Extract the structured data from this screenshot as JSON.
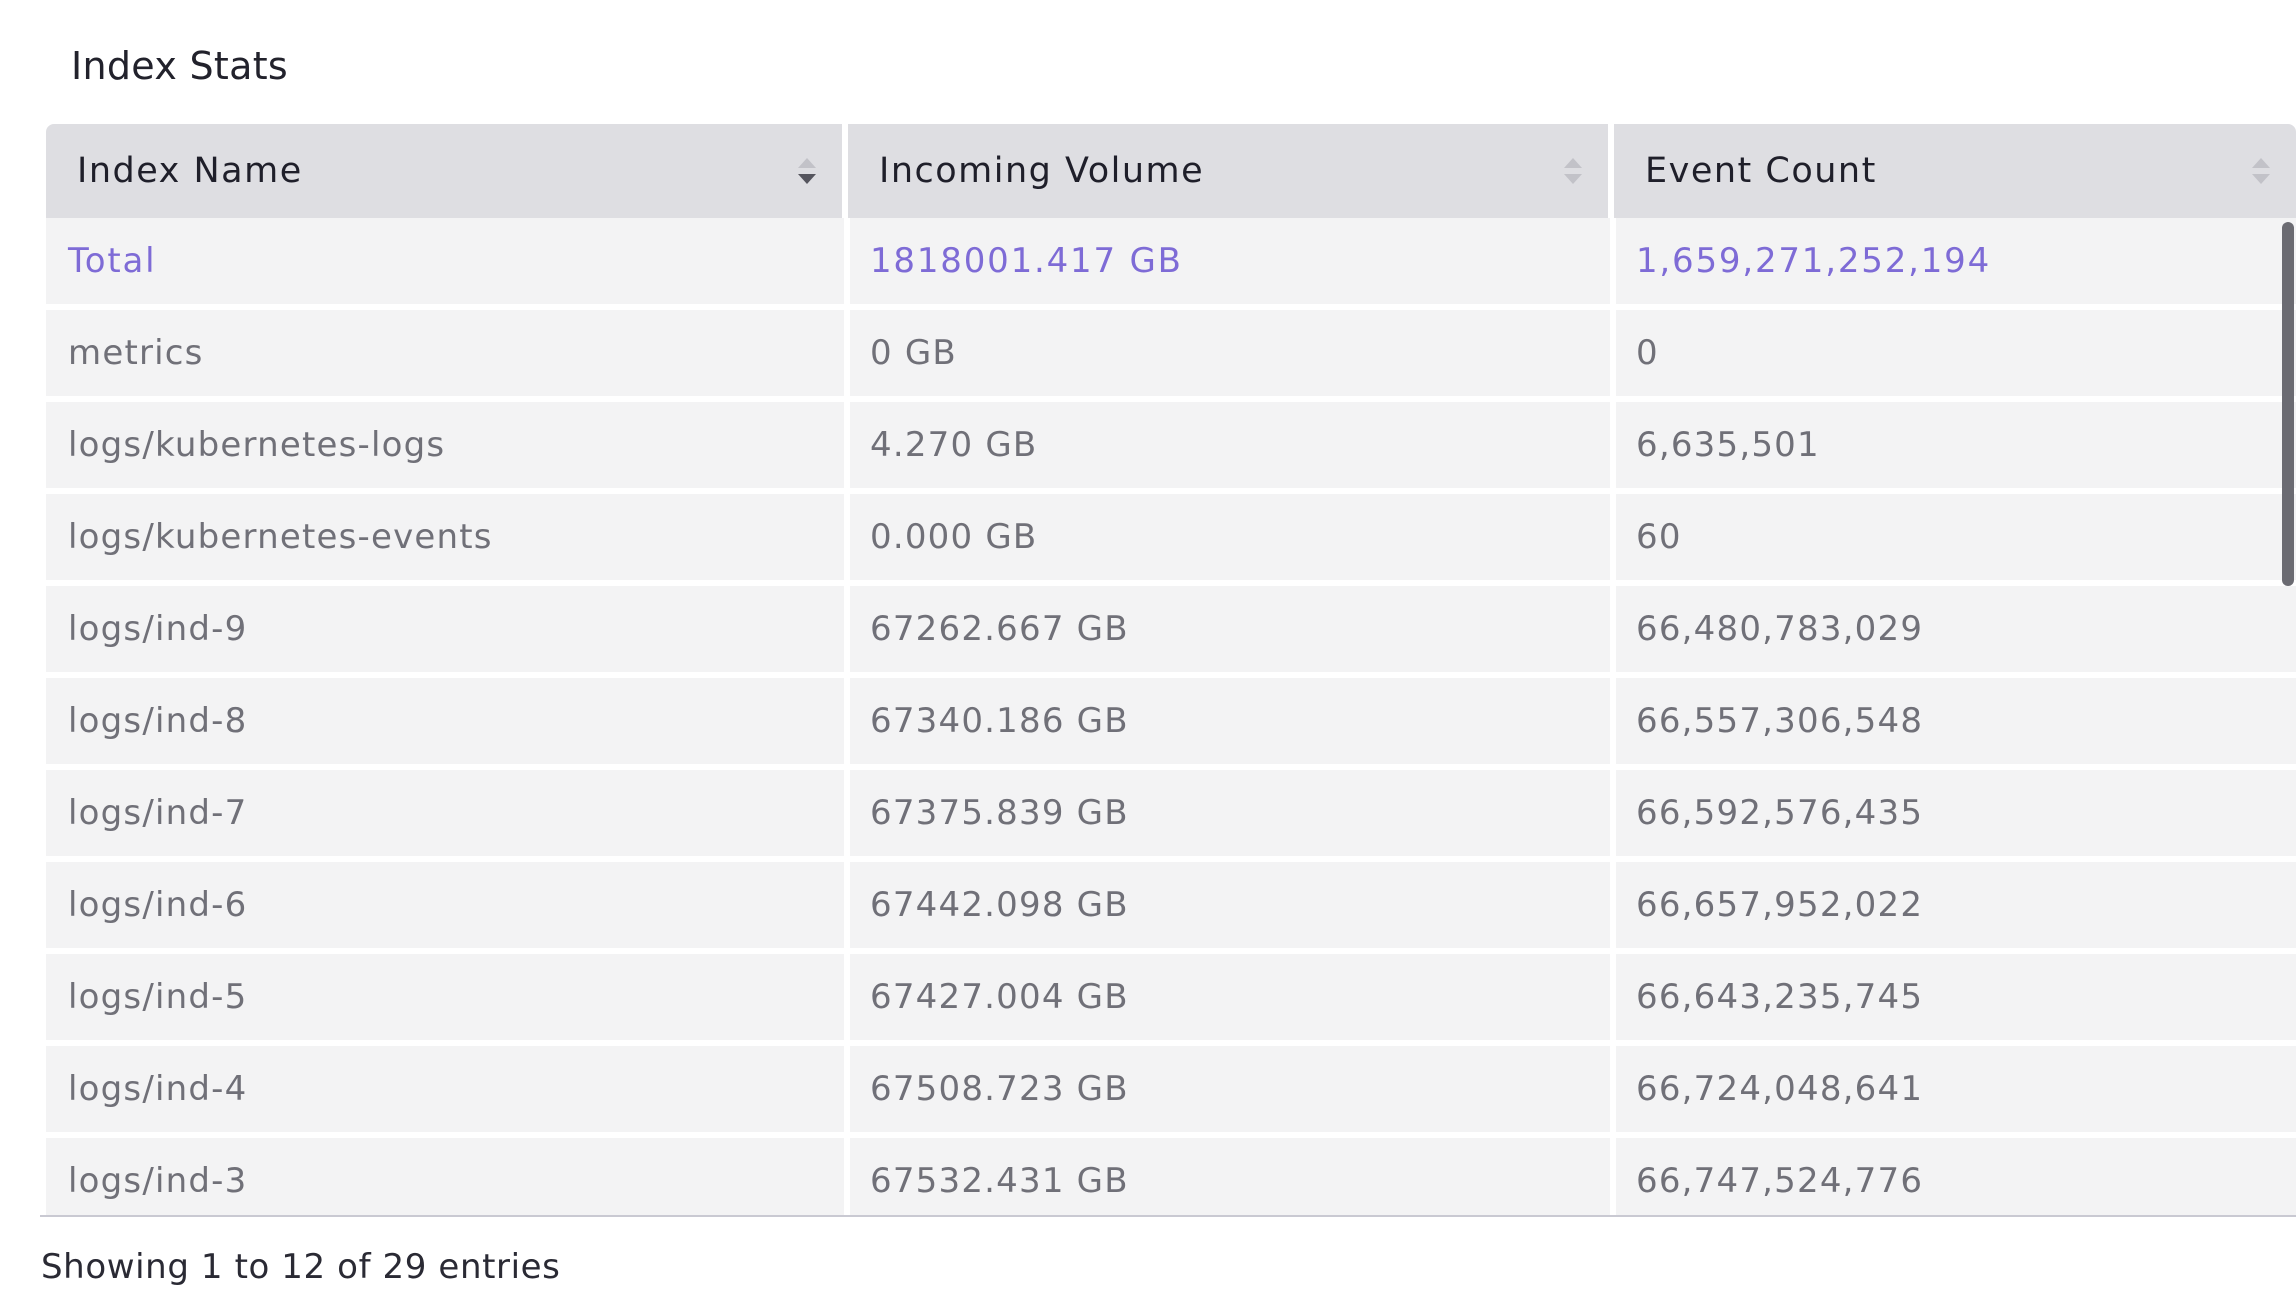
{
  "page": {
    "title": "Index Stats"
  },
  "table": {
    "columns": [
      "Index Name",
      "Incoming Volume",
      "Event Count"
    ],
    "sorted_column": "Index Name",
    "sort_direction": "descending",
    "total": [
      "Total",
      "1818001.417 GB",
      "1,659,271,252,194"
    ],
    "rows": [
      [
        "metrics",
        "0 GB",
        "0"
      ],
      [
        "logs/kubernetes-logs",
        "4.270 GB",
        "6,635,501"
      ],
      [
        "logs/kubernetes-events",
        "0.000 GB",
        "60"
      ],
      [
        "logs/ind-9",
        "67262.667 GB",
        "66,480,783,029"
      ],
      [
        "logs/ind-8",
        "67340.186 GB",
        "66,557,306,548"
      ],
      [
        "logs/ind-7",
        "67375.839 GB",
        "66,592,576,435"
      ],
      [
        "logs/ind-6",
        "67442.098 GB",
        "66,657,952,022"
      ],
      [
        "logs/ind-5",
        "67427.004 GB",
        "66,643,235,745"
      ],
      [
        "logs/ind-4",
        "67508.723 GB",
        "66,724,048,641"
      ],
      [
        "logs/ind-3",
        "67532.431 GB",
        "66,747,524,776"
      ]
    ]
  },
  "footer": {
    "info": "Showing 1 to 12 of 29 entries"
  },
  "colors": {
    "accent": "#7e6bd6",
    "header_bg": "#dedee2",
    "row_bg": "#f3f3f4"
  }
}
